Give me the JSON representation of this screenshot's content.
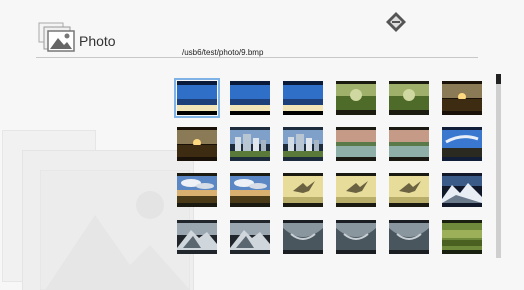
{
  "header": {
    "title": "Photo",
    "path": "/usb6/test/photo/9.bmp"
  },
  "icons": {
    "photo_app_icon": "photo-stack-icon",
    "brand_logo": "diamond-logo-icon"
  },
  "thumbnails": [
    {
      "name": "thumb-ocean-pier",
      "kind": "ocean",
      "selected": true
    },
    {
      "name": "thumb-sea-blue-1",
      "kind": "ocean",
      "selected": false
    },
    {
      "name": "thumb-sea-blue-2",
      "kind": "ocean",
      "selected": false
    },
    {
      "name": "thumb-green-landscape-1",
      "kind": "green",
      "selected": false
    },
    {
      "name": "thumb-green-landscape-2",
      "kind": "green",
      "selected": false
    },
    {
      "name": "thumb-sunset-field",
      "kind": "sunset",
      "selected": false
    },
    {
      "name": "thumb-sunset-sea",
      "kind": "sunset",
      "selected": false
    },
    {
      "name": "thumb-city-skyline-1",
      "kind": "city",
      "selected": false
    },
    {
      "name": "thumb-city-skyline-2",
      "kind": "city",
      "selected": false
    },
    {
      "name": "thumb-lake-dusk-1",
      "kind": "lake",
      "selected": false
    },
    {
      "name": "thumb-lake-dusk-2",
      "kind": "lake",
      "selected": false
    },
    {
      "name": "thumb-blue-sky",
      "kind": "sky",
      "selected": false
    },
    {
      "name": "thumb-clouds-horizon",
      "kind": "clouds",
      "selected": false
    },
    {
      "name": "thumb-clouds-sea",
      "kind": "clouds",
      "selected": false
    },
    {
      "name": "thumb-bird-flight-1",
      "kind": "bird",
      "selected": false
    },
    {
      "name": "thumb-bird-flight-2",
      "kind": "bird",
      "selected": false
    },
    {
      "name": "thumb-bird-flight-3",
      "kind": "bird",
      "selected": false
    },
    {
      "name": "thumb-mountains-snow",
      "kind": "mountains",
      "selected": false
    },
    {
      "name": "thumb-mountain-peak-1",
      "kind": "peak",
      "selected": false
    },
    {
      "name": "thumb-mountain-peak-2",
      "kind": "peak",
      "selected": false
    },
    {
      "name": "thumb-canyon-1",
      "kind": "canyon",
      "selected": false
    },
    {
      "name": "thumb-canyon-2",
      "kind": "canyon",
      "selected": false
    },
    {
      "name": "thumb-canyon-3",
      "kind": "canyon",
      "selected": false
    },
    {
      "name": "thumb-green-moss",
      "kind": "moss",
      "selected": false
    }
  ],
  "scroll": {
    "position": 0.0
  }
}
